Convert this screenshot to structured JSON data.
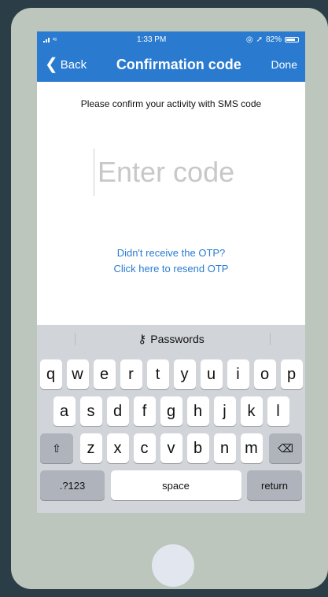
{
  "status_bar": {
    "time": "1:33 PM",
    "battery": "82%"
  },
  "nav": {
    "back_label": "Back",
    "back_chevron": "❮",
    "title": "Confirmation code",
    "done_label": "Done"
  },
  "main": {
    "prompt": "Please confirm your activity with SMS code",
    "code_placeholder": "Enter code",
    "code_value": "",
    "resend_line1": "Didn't receive the OTP?",
    "resend_line2": "Click here to resend OTP"
  },
  "keyboard": {
    "suggestion_icon": "key-icon",
    "suggestion_label": "Passwords",
    "row1": [
      "q",
      "w",
      "e",
      "r",
      "t",
      "y",
      "u",
      "i",
      "o",
      "p"
    ],
    "row2": [
      "a",
      "s",
      "d",
      "f",
      "g",
      "h",
      "j",
      "k",
      "l"
    ],
    "row3": [
      "z",
      "x",
      "c",
      "v",
      "b",
      "n",
      "m"
    ],
    "shift_icon": "shift-icon",
    "delete_icon": "delete-icon",
    "num_label": ".?123",
    "space_label": "space",
    "return_label": "return"
  },
  "colors": {
    "brand": "#2a7bd0",
    "keyboard_bg": "#d1d4d9",
    "device_bg": "#bcc6bc",
    "page_bg": "#2b3d47"
  }
}
